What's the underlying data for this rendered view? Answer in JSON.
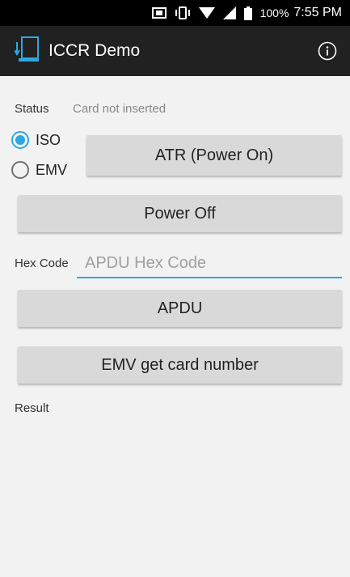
{
  "status_bar": {
    "battery_percent": "100%",
    "time": "7:55 PM"
  },
  "app_bar": {
    "title": "ICCR Demo",
    "info_icon": "info-icon",
    "app_icon": "card-reader-icon"
  },
  "status": {
    "label": "Status",
    "value": "Card not inserted"
  },
  "modes": {
    "iso_label": "ISO",
    "emv_label": "EMV",
    "selected": "ISO"
  },
  "buttons": {
    "atr_label": "ATR (Power On)",
    "power_off_label": "Power Off",
    "apdu_label": "APDU",
    "emv_card_label": "EMV get card number"
  },
  "hex": {
    "label": "Hex Code",
    "placeholder": "APDU Hex Code",
    "value": ""
  },
  "result": {
    "label": "Result"
  },
  "colors": {
    "accent": "#2ea7e0",
    "app_bar": "#212121",
    "button": "#d9d9d9",
    "background": "#f2f2f2"
  }
}
